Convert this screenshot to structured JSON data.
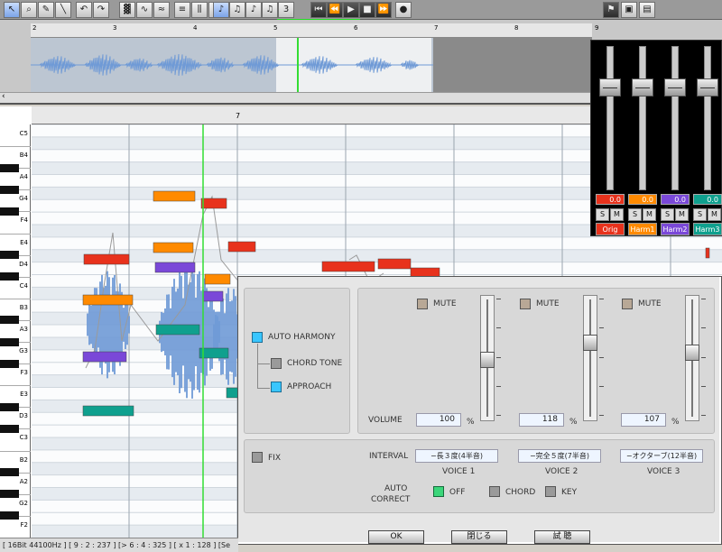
{
  "toolbar": {
    "tool_icons": [
      "pointer-icon",
      "magnifier-icon",
      "pen-icon",
      "eraser-icon",
      "undo-icon",
      "redo-icon",
      "note-view-icon",
      "pitch-view-icon",
      "wave-view-icon",
      "list-view-icon",
      "split-icon",
      "grid-icon",
      "note-8th-icon",
      "note-16th-icon",
      "note-32nd-icon",
      "note-64th-icon",
      "triplet-icon",
      "go-start-icon",
      "rewind-icon",
      "play-icon",
      "stop-icon",
      "fast-forward-icon",
      "record-icon",
      "flag-icon",
      "copy-icon",
      "paste-icon"
    ],
    "triplet_label": "3"
  },
  "timeline": {
    "overview_markers": [
      "2",
      "3",
      "4",
      "5",
      "6",
      "7",
      "8",
      "9"
    ],
    "editor_marker": "7"
  },
  "piano": {
    "labels": [
      "C5",
      "B4",
      "A4",
      "G4",
      "F4",
      "E4",
      "D4",
      "C4",
      "B3",
      "A3",
      "G3",
      "F3",
      "E3",
      "D3",
      "C3",
      "B2",
      "A2",
      "G2",
      "F2"
    ]
  },
  "colors": {
    "orig": "#e8321c",
    "harm1": "#ff8a00",
    "harm2": "#7a48d8",
    "harm3": "#0fa08e",
    "wave": "#6f9ad6",
    "playhead": "#33dd33"
  },
  "mixer": {
    "channels": [
      {
        "name": "Orig",
        "value": "0.0",
        "color": "#e8321c",
        "level": 0.33
      },
      {
        "name": "Harm1",
        "value": "0.0",
        "color": "#ff8a00",
        "level": 0.33
      },
      {
        "name": "Harm2",
        "value": "0.0",
        "color": "#7a48d8",
        "level": 0.33
      },
      {
        "name": "Harm3",
        "value": "0.0",
        "color": "#0fa08e",
        "level": 0.33
      }
    ],
    "solo_label": "S",
    "mute_label": "M"
  },
  "dialog": {
    "auto_harmony": "AUTO HARMONY",
    "chord_tone": "CHORD TONE",
    "approach": "APPROACH",
    "fix": "FIX",
    "volume_label": "VOLUME",
    "interval_label": "INTERVAL",
    "auto_correct_line1": "AUTO",
    "auto_correct_line2": "CORRECT",
    "mute_label": "MUTE",
    "percent": "%",
    "voices": [
      {
        "name": "VOICE 1",
        "volume": "100",
        "interval": "−長３度(4半音)",
        "level": 0.52
      },
      {
        "name": "VOICE 2",
        "volume": "118",
        "interval": "−完全５度(7半音)",
        "level": 0.35
      },
      {
        "name": "VOICE 3",
        "volume": "107",
        "interval": "−オクターブ(12半音)",
        "level": 0.45
      }
    ],
    "correct_options": {
      "off": "OFF",
      "chord": "CHORD",
      "key": "KEY"
    },
    "buttons": {
      "ok": "OK",
      "close": "閉じる",
      "audition": "試 聴"
    }
  },
  "status": "[ 16Bit  44100Hz ]  [ 9 : 2 : 237 ]  [> 6 : 4 : 325 ]  [ x 1 : 128 ]  [Se"
}
